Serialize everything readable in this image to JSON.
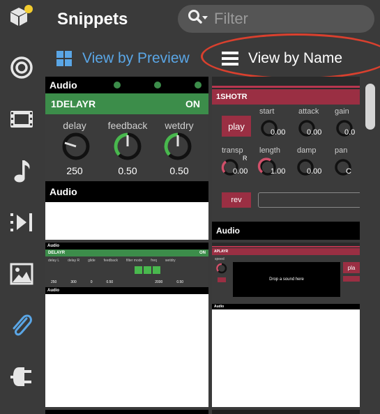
{
  "header": {
    "title": "Snippets",
    "filter_placeholder": "Filter"
  },
  "view_modes": {
    "preview_label": "View by Preview",
    "name_label": "View by Name",
    "active": "preview",
    "accent_color": "#5aa6e6",
    "highlight_color": "#d9402e"
  },
  "rail": {
    "items": [
      {
        "icon": "package-icon"
      },
      {
        "icon": "target-icon"
      },
      {
        "icon": "film-icon"
      },
      {
        "icon": "music-note-icon"
      },
      {
        "icon": "media-playlist-icon"
      },
      {
        "icon": "image-icon"
      },
      {
        "icon": "paperclip-icon",
        "active": true
      },
      {
        "icon": "plug-icon"
      }
    ]
  },
  "snippets": {
    "delayr": {
      "top_label": "Audio",
      "device": "1DELAYR",
      "status": "ON",
      "knobs": [
        {
          "label": "delay",
          "value": "250"
        },
        {
          "label": "feedback",
          "value": "0.50"
        },
        {
          "label": "wetdry",
          "value": "0.50"
        }
      ],
      "bottom_label": "Audio"
    },
    "shotr": {
      "device": "1SHOTR",
      "play": "play",
      "rev": "rev",
      "row1": [
        {
          "label": "start",
          "value": "0.00"
        },
        {
          "label": "attack",
          "value": "0.00"
        },
        {
          "label": "gain",
          "value": "0.0"
        }
      ],
      "row2": [
        {
          "label": "transp",
          "value": "0.00",
          "badge": "R"
        },
        {
          "label": "length",
          "value": "1.00"
        },
        {
          "label": "damp",
          "value": "0.00"
        },
        {
          "label": "pan",
          "value": "C"
        }
      ],
      "bottom_label": "Audio"
    },
    "delayr_small": {
      "top_label": "Audio",
      "device": "DELAYR",
      "status": "ON",
      "labels": [
        "delay L",
        "delay R",
        "glide",
        "feedback",
        "filter mode",
        "freq",
        "wetdry"
      ],
      "values": [
        "250",
        "300",
        "0",
        "0.50",
        "2000",
        "0.50"
      ],
      "bottom_label": "Audio"
    },
    "aplayr": {
      "device": "APLAYR",
      "speed_label": "speed",
      "drop_text": "Drop a sound here",
      "play": "pla",
      "bottom_label": "Audio"
    }
  }
}
